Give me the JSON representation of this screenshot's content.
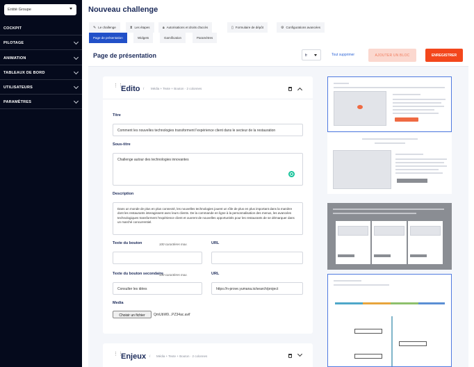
{
  "sidebar": {
    "entity": "Entité Groupe",
    "items": [
      {
        "label": "COCKPIT",
        "chevron": false
      },
      {
        "label": "PILOTAGE",
        "chevron": true
      },
      {
        "label": "ANIMATION",
        "chevron": true
      },
      {
        "label": "TABLEAUX DE BORD",
        "chevron": true
      },
      {
        "label": "UTILISATEURS",
        "chevron": true
      },
      {
        "label": "PARAMÈTRES",
        "chevron": true
      }
    ]
  },
  "header": {
    "title": "Nouveau challenge"
  },
  "tabs": [
    {
      "label": "Le challenge",
      "icon": "pencil-icon"
    },
    {
      "label": "Les étapes",
      "icon": "hourglass-icon"
    },
    {
      "label": "Autorisations et droits d'accès",
      "icon": "lock-icon"
    },
    {
      "label": "Formulaire de dépôt",
      "icon": "file-icon"
    },
    {
      "label": "Configurations avancées",
      "icon": "gear-icon"
    }
  ],
  "subtabs": [
    {
      "label": "Page de présentation",
      "active": true
    },
    {
      "label": "Widgets",
      "active": false
    },
    {
      "label": "Gamification",
      "active": false
    },
    {
      "label": "Paramètres",
      "active": false
    }
  ],
  "content": {
    "title": "Page de présentation",
    "lang": "fr",
    "delete_all": "Tout supprimer",
    "add_block": "AJOUTER UN BLOC",
    "save": "ENREGISTRER"
  },
  "block1": {
    "title": "Edito",
    "separator": "/",
    "subtitle": "Média + Texte + Bouton · 2 colonnes",
    "title_label": "Titre",
    "title_value": "Comment les nouvelles technologies transforment l'expérience client dans le secteur de la restauration",
    "subtitle_label": "Sous-titre",
    "subtitle_value": "Challenge autour des technologies innovantes",
    "description_label": "Description",
    "description_value": "Dans un monde de plus en plus connecté, les nouvelles technologies jouent un rôle de plus en plus important dans la manière dont les restaurants interagissent avec leurs clients. De la commande en ligne à la personnalisation des menus, les avancées technologiques transforment l'expérience client et ouvrent de nouvelles opportunités pour les restaurants de se démarquer dans un marché concurrentiel.",
    "button_label": "Texte du bouton",
    "button_hint": "100 caractères max.",
    "button_value": "",
    "url_label": "URL",
    "url_value": "",
    "button2_label": "Texte du bouton secondaire",
    "button2_hint": "100 caractères max.",
    "button2_value": "Consulter les idées",
    "url2_label": "URL",
    "url2_value": "https://n-prove.yumana.io/search/project",
    "media_label": "Media",
    "file_button": "Choisir un fichier",
    "file_name": "QmUbW9...PZ34ac.avif"
  },
  "block2": {
    "title": "Enjeux",
    "separator": "/",
    "subtitle": "Média + Texte + Bouton · 2 colonnes"
  },
  "colors": {
    "accent": "#2150c8",
    "save": "#f3471c",
    "add": "#fbd8cf",
    "sidebar": "#050a1c"
  }
}
